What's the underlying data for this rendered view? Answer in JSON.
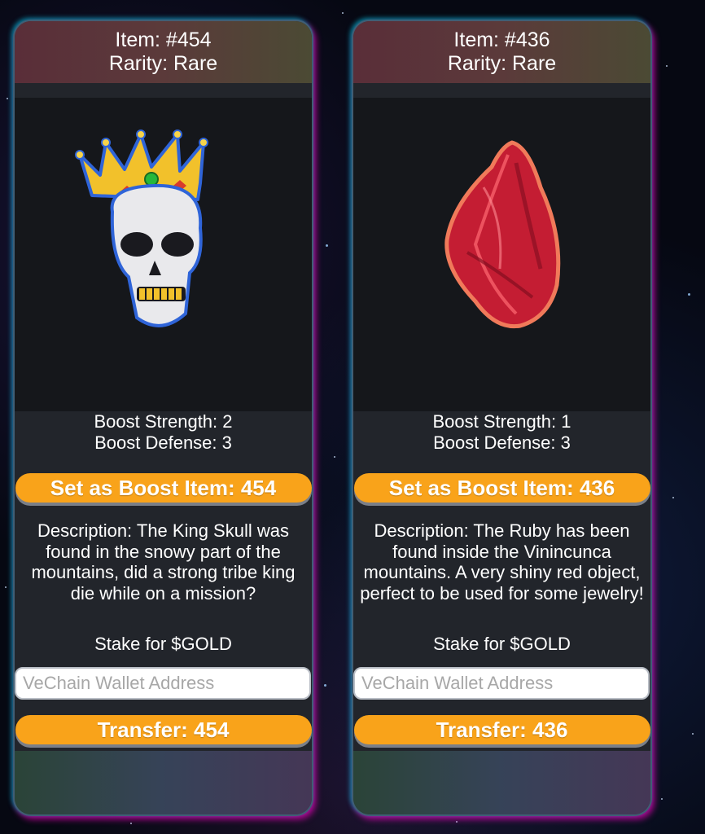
{
  "items": [
    {
      "id_label": "Item: #454",
      "rarity": "Rarity: Rare",
      "art_icon": "king-skull-icon",
      "boost_strength": "Boost Strength: 2",
      "boost_defense": "Boost Defense: 3",
      "boost_button": "Set as Boost Item: 454",
      "description": "Description: The King Skull was found in the snowy part of the mountains, did a strong tribe king die while on a mission?",
      "stake_label": "Stake for $GOLD",
      "wallet_placeholder": "VeChain Wallet Address",
      "transfer_button": "Transfer: 454"
    },
    {
      "id_label": "Item: #436",
      "rarity": "Rarity: Rare",
      "art_icon": "ruby-gem-icon",
      "boost_strength": "Boost Strength: 1",
      "boost_defense": "Boost Defense: 3",
      "boost_button": "Set as Boost Item: 436",
      "description": "Description: The Ruby has been found inside the Vinincunca mountains. A very shiny red object, perfect to be used for some jewelry!",
      "stake_label": "Stake for $GOLD",
      "wallet_placeholder": "VeChain Wallet Address",
      "transfer_button": "Transfer: 436"
    }
  ],
  "colors": {
    "button": "#f9a31a",
    "card": "#22252b",
    "glow_cyan": "#00dcff",
    "glow_magenta": "#ff00c8"
  }
}
